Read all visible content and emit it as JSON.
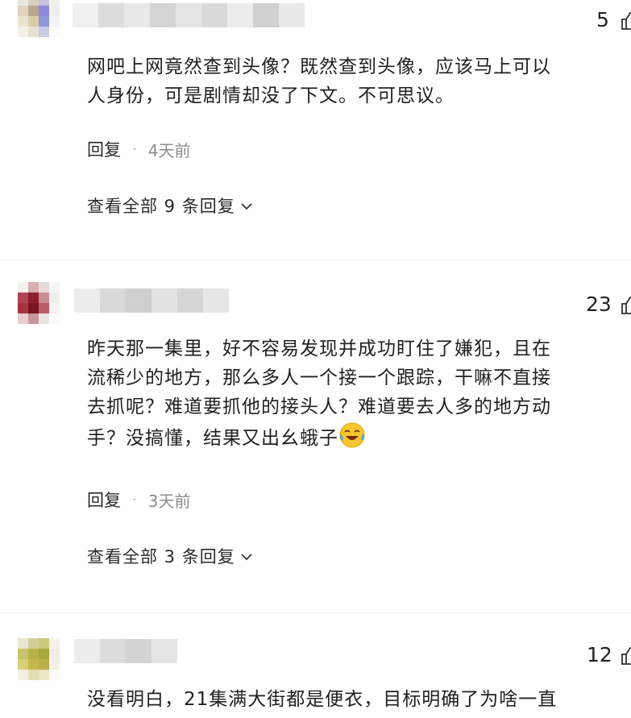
{
  "comments": [
    {
      "likes": "5",
      "text_lines": [
        "网吧上网竟然查到头像？既然查到头像，应该马上可以",
        "人身份，可是剧情却没了下文。不可思议。"
      ],
      "reply_label": "回复",
      "separator": "·",
      "time": "4天前",
      "view_replies": "查看全部 9 条回复"
    },
    {
      "likes": "23",
      "text_lines": [
        "昨天那一集里，好不容易发现并成功盯住了嫌犯，且在",
        "流稀少的地方，那么多人一个接一个跟踪，干嘛不直接",
        "去抓呢？难道要抓他的接头人？难道要去人多的地方动",
        "手？没搞懂，结果又出幺蛾子"
      ],
      "emoji": "laughing-crying-emoji",
      "reply_label": "回复",
      "separator": "·",
      "time": "3天前",
      "view_replies": "查看全部 3 条回复"
    },
    {
      "likes": "12",
      "text_lines": [
        "没看明白，21集满大街都是便衣，目标明确了为啥一直"
      ]
    }
  ]
}
